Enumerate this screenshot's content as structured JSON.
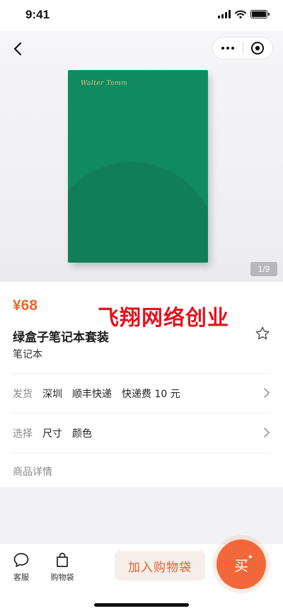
{
  "status_bar": {
    "time": "9:41"
  },
  "product": {
    "image_page": "1/9",
    "image_brand": "Walter Tomm",
    "price": "¥68",
    "title": "绿盒子笔记本套装",
    "subtitle": "笔记本"
  },
  "watermark": "飞翔网络创业",
  "shipping": {
    "label": "发货",
    "location": "深圳",
    "carrier": "顺丰快递",
    "fee": "快递费 10 元"
  },
  "options": {
    "label": "选择",
    "size": "尺寸",
    "color": "颜色"
  },
  "details_label": "商品详情",
  "bottom_bar": {
    "service": "客服",
    "bag": "购物袋",
    "add_to_bag": "加入购物袋",
    "buy": "买"
  },
  "colors": {
    "accent": "#f0652f",
    "cover": "#118a62",
    "watermark": "#e1141f"
  }
}
